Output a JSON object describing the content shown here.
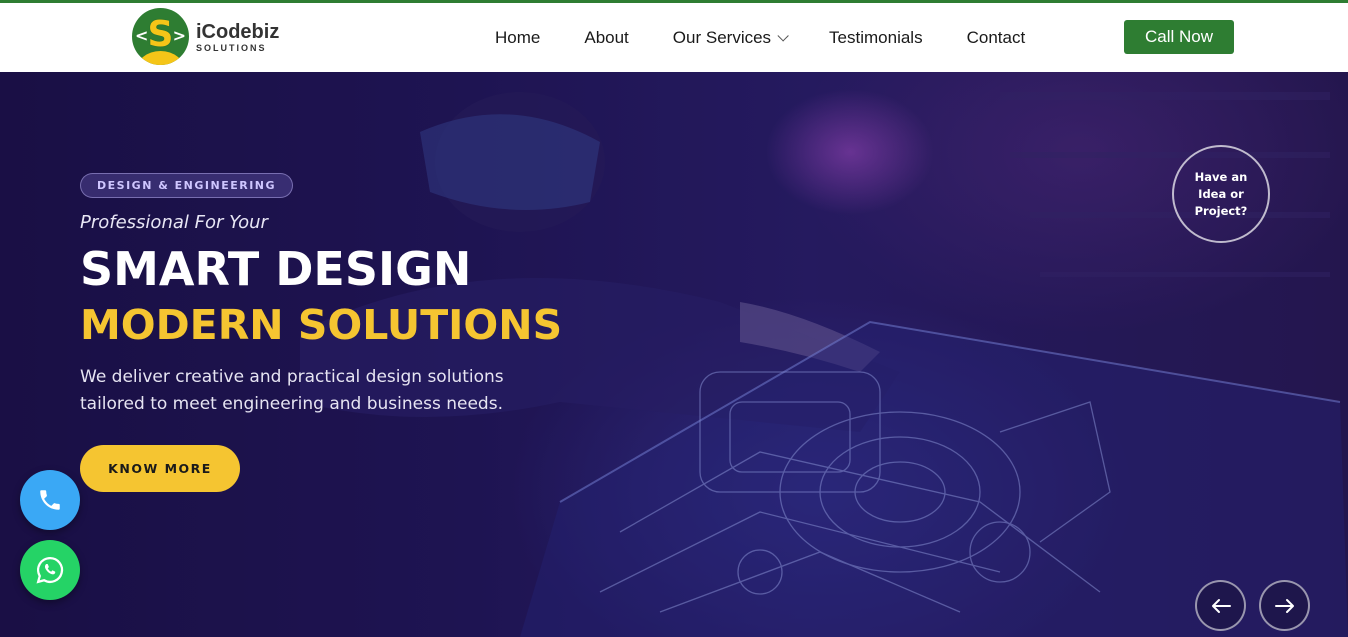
{
  "brand": {
    "name": "iCodebiz",
    "subtitle": "SOLUTIONS",
    "mark_letter": "S"
  },
  "nav": {
    "items": [
      {
        "label": "Home"
      },
      {
        "label": "About"
      },
      {
        "label": "Our Services",
        "has_dropdown": true
      },
      {
        "label": "Testimonials"
      },
      {
        "label": "Contact"
      }
    ],
    "cta_label": "Call Now"
  },
  "hero": {
    "badge": "DESIGN & ENGINEERING",
    "kicker": "Professional For Your",
    "title_line1": "SMART DESIGN",
    "title_line2": "MODERN SOLUTIONS",
    "description": "We deliver creative and practical design solutions tailored to meet engineering and business needs.",
    "button_label": "KNOW MORE",
    "idea_circle": "Have an Idea or Project?"
  },
  "floating": {
    "phone_icon": "phone-icon",
    "whatsapp_icon": "whatsapp-icon"
  },
  "slider": {
    "prev_icon": "arrow-left-icon",
    "next_icon": "arrow-right-icon"
  },
  "colors": {
    "brand_green": "#2e7d32",
    "accent_yellow": "#f5c531",
    "phone_blue": "#3aa8f5",
    "whatsapp_green": "#25d366",
    "hero_bg": "#1c1148"
  }
}
